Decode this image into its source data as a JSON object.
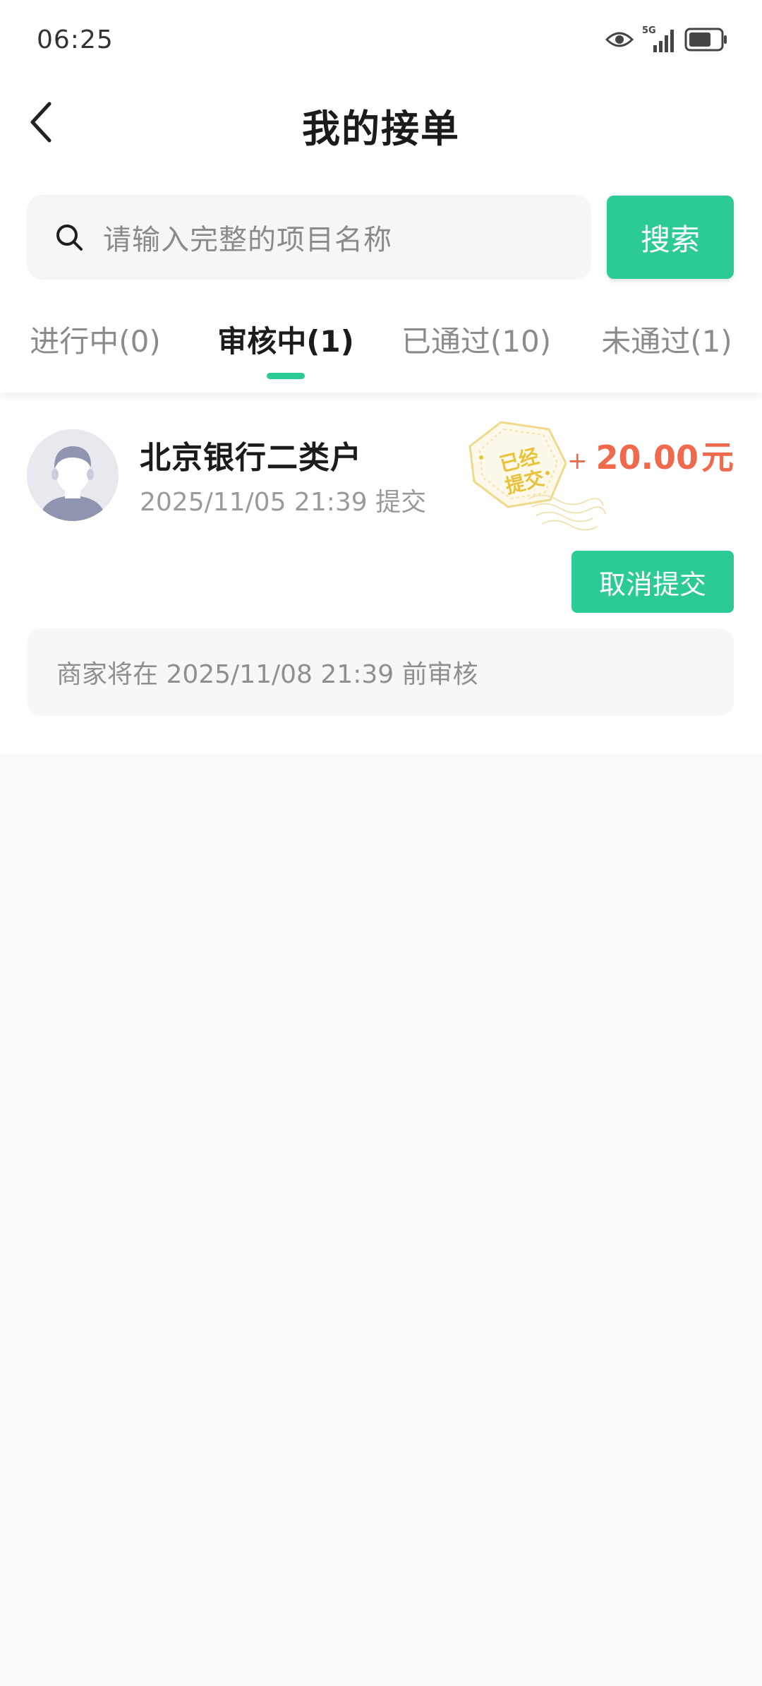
{
  "status_bar": {
    "time": "06:25",
    "network": "5G"
  },
  "nav": {
    "title": "我的接单"
  },
  "search": {
    "placeholder": "请输入完整的项目名称",
    "button_label": "搜索"
  },
  "tabs": [
    {
      "label": "进行中(0)",
      "active": false
    },
    {
      "label": "审核中(1)",
      "active": true
    },
    {
      "label": "已通过(10)",
      "active": false
    },
    {
      "label": "未通过(1)",
      "active": false
    }
  ],
  "orders": [
    {
      "name": "北京银行二类户",
      "submit_time": "2025/11/05 21:39 提交",
      "stamp": "已经\n提交",
      "reward_plus": "+",
      "reward_amount": "20.00",
      "reward_unit": "元",
      "cancel_label": "取消提交",
      "notice": "商家将在 2025/11/08 21:39 前审核"
    }
  ],
  "colors": {
    "accent": "#2dcb94",
    "reward": "#ef6a4d",
    "stamp": "#e9c23b"
  }
}
